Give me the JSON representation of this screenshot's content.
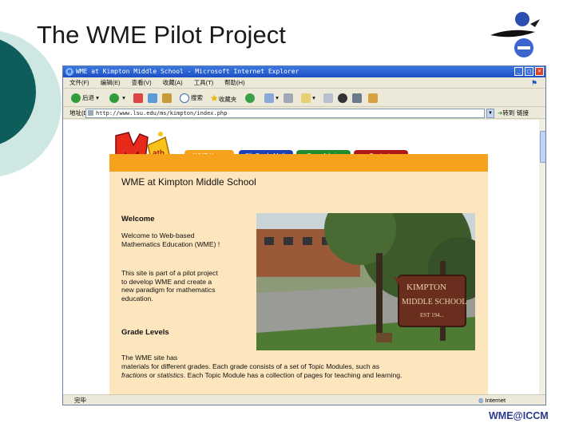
{
  "slide": {
    "title": "The WME Pilot Project",
    "footer_logo": "WME@ICCM"
  },
  "browser": {
    "window_title": "WME at Kimpton Middle School - Microsoft Internet Explorer",
    "menu": [
      "文件(F)",
      "编辑(E)",
      "查看(V)",
      "收藏(A)",
      "工具(T)",
      "帮助(H)"
    ],
    "toolbar": {
      "back_label": "后退",
      "search_label": "搜索",
      "favorites_label": "收藏夹"
    },
    "address_label": "地址(D)",
    "address_value": "http://www.lsu.edu/ms/kimpton/index.php",
    "go_label": "转到",
    "links_label": "链接",
    "status_left": "完毕",
    "status_right": "Internet"
  },
  "webpage": {
    "nav_tabs": [
      {
        "label": "WME Home",
        "color": "#f7a21c"
      },
      {
        "label": "7th Grade Math",
        "color": "#1f3fb5"
      },
      {
        "label": "Page Admin",
        "color": "#1e8c2e"
      },
      {
        "label": "Contacts",
        "color": "#b01818"
      }
    ],
    "heading": "WME at Kimpton Middle School",
    "welcome_heading": "Welcome",
    "welcome_text": "Welcome to Web-based Mathematics Education (WME) !",
    "pilot_text": "This site is part of a pilot project to develop WME and create a new paradigm for mathematics education.",
    "grade_heading": "Grade Levels",
    "grade_text_1": "The WME site has",
    "grade_text_2": "materials for different grades. Each grade consists of a set of Topic Modules, such as",
    "grade_text_3a": "fractions",
    "grade_text_3b": " or ",
    "grade_text_3c": "statistics",
    "grade_text_3d": ". Each Topic Module has a collection of pages for teaching and learning.",
    "sign_line1": "KIMPTON",
    "sign_line2": "MIDDLE SCHOOL",
    "sign_line3": "EST 194..."
  },
  "colors": {
    "orange": "#f7a21c",
    "content_bg": "#fde6bd",
    "slide_teal": "#0d5e5a"
  }
}
